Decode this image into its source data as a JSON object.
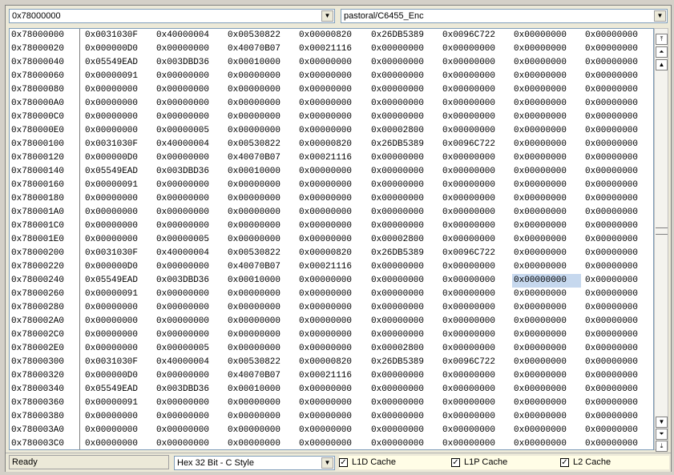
{
  "toolbar": {
    "address_value": "0x78000000",
    "target_value": "pastoral/C6455_Enc"
  },
  "memory": {
    "rows": [
      [
        "0x78000000",
        "0x0031030F",
        "0x40000004",
        "0x00530822",
        "0x00000820",
        "0x26DB5389",
        "0x0096C722",
        "0x00000000",
        "0x00000000"
      ],
      [
        "0x78000020",
        "0x000000D0",
        "0x00000000",
        "0x40070B07",
        "0x00021116",
        "0x00000000",
        "0x00000000",
        "0x00000000",
        "0x00000000"
      ],
      [
        "0x78000040",
        "0x05549EAD",
        "0x003DBD36",
        "0x00010000",
        "0x00000000",
        "0x00000000",
        "0x00000000",
        "0x00000000",
        "0x00000000"
      ],
      [
        "0x78000060",
        "0x00000091",
        "0x00000000",
        "0x00000000",
        "0x00000000",
        "0x00000000",
        "0x00000000",
        "0x00000000",
        "0x00000000"
      ],
      [
        "0x78000080",
        "0x00000000",
        "0x00000000",
        "0x00000000",
        "0x00000000",
        "0x00000000",
        "0x00000000",
        "0x00000000",
        "0x00000000"
      ],
      [
        "0x780000A0",
        "0x00000000",
        "0x00000000",
        "0x00000000",
        "0x00000000",
        "0x00000000",
        "0x00000000",
        "0x00000000",
        "0x00000000"
      ],
      [
        "0x780000C0",
        "0x00000000",
        "0x00000000",
        "0x00000000",
        "0x00000000",
        "0x00000000",
        "0x00000000",
        "0x00000000",
        "0x00000000"
      ],
      [
        "0x780000E0",
        "0x00000000",
        "0x00000005",
        "0x00000000",
        "0x00000000",
        "0x00002800",
        "0x00000000",
        "0x00000000",
        "0x00000000"
      ],
      [
        "0x78000100",
        "0x0031030F",
        "0x40000004",
        "0x00530822",
        "0x00000820",
        "0x26DB5389",
        "0x0096C722",
        "0x00000000",
        "0x00000000"
      ],
      [
        "0x78000120",
        "0x000000D0",
        "0x00000000",
        "0x40070B07",
        "0x00021116",
        "0x00000000",
        "0x00000000",
        "0x00000000",
        "0x00000000"
      ],
      [
        "0x78000140",
        "0x05549EAD",
        "0x003DBD36",
        "0x00010000",
        "0x00000000",
        "0x00000000",
        "0x00000000",
        "0x00000000",
        "0x00000000"
      ],
      [
        "0x78000160",
        "0x00000091",
        "0x00000000",
        "0x00000000",
        "0x00000000",
        "0x00000000",
        "0x00000000",
        "0x00000000",
        "0x00000000"
      ],
      [
        "0x78000180",
        "0x00000000",
        "0x00000000",
        "0x00000000",
        "0x00000000",
        "0x00000000",
        "0x00000000",
        "0x00000000",
        "0x00000000"
      ],
      [
        "0x780001A0",
        "0x00000000",
        "0x00000000",
        "0x00000000",
        "0x00000000",
        "0x00000000",
        "0x00000000",
        "0x00000000",
        "0x00000000"
      ],
      [
        "0x780001C0",
        "0x00000000",
        "0x00000000",
        "0x00000000",
        "0x00000000",
        "0x00000000",
        "0x00000000",
        "0x00000000",
        "0x00000000"
      ],
      [
        "0x780001E0",
        "0x00000000",
        "0x00000005",
        "0x00000000",
        "0x00000000",
        "0x00002800",
        "0x00000000",
        "0x00000000",
        "0x00000000"
      ],
      [
        "0x78000200",
        "0x0031030F",
        "0x40000004",
        "0x00530822",
        "0x00000820",
        "0x26DB5389",
        "0x0096C722",
        "0x00000000",
        "0x00000000"
      ],
      [
        "0x78000220",
        "0x000000D0",
        "0x00000000",
        "0x40070B07",
        "0x00021116",
        "0x00000000",
        "0x00000000",
        "0x00000000",
        "0x00000000"
      ],
      [
        "0x78000240",
        "0x05549EAD",
        "0x003DBD36",
        "0x00010000",
        "0x00000000",
        "0x00000000",
        "0x00000000",
        "0x00000000",
        "0x00000000"
      ],
      [
        "0x78000260",
        "0x00000091",
        "0x00000000",
        "0x00000000",
        "0x00000000",
        "0x00000000",
        "0x00000000",
        "0x00000000",
        "0x00000000"
      ],
      [
        "0x78000280",
        "0x00000000",
        "0x00000000",
        "0x00000000",
        "0x00000000",
        "0x00000000",
        "0x00000000",
        "0x00000000",
        "0x00000000"
      ],
      [
        "0x780002A0",
        "0x00000000",
        "0x00000000",
        "0x00000000",
        "0x00000000",
        "0x00000000",
        "0x00000000",
        "0x00000000",
        "0x00000000"
      ],
      [
        "0x780002C0",
        "0x00000000",
        "0x00000000",
        "0x00000000",
        "0x00000000",
        "0x00000000",
        "0x00000000",
        "0x00000000",
        "0x00000000"
      ],
      [
        "0x780002E0",
        "0x00000000",
        "0x00000005",
        "0x00000000",
        "0x00000000",
        "0x00002800",
        "0x00000000",
        "0x00000000",
        "0x00000000"
      ],
      [
        "0x78000300",
        "0x0031030F",
        "0x40000004",
        "0x00530822",
        "0x00000820",
        "0x26DB5389",
        "0x0096C722",
        "0x00000000",
        "0x00000000"
      ],
      [
        "0x78000320",
        "0x000000D0",
        "0x00000000",
        "0x40070B07",
        "0x00021116",
        "0x00000000",
        "0x00000000",
        "0x00000000",
        "0x00000000"
      ],
      [
        "0x78000340",
        "0x05549EAD",
        "0x003DBD36",
        "0x00010000",
        "0x00000000",
        "0x00000000",
        "0x00000000",
        "0x00000000",
        "0x00000000"
      ],
      [
        "0x78000360",
        "0x00000091",
        "0x00000000",
        "0x00000000",
        "0x00000000",
        "0x00000000",
        "0x00000000",
        "0x00000000",
        "0x00000000"
      ],
      [
        "0x78000380",
        "0x00000000",
        "0x00000000",
        "0x00000000",
        "0x00000000",
        "0x00000000",
        "0x00000000",
        "0x00000000",
        "0x00000000"
      ],
      [
        "0x780003A0",
        "0x00000000",
        "0x00000000",
        "0x00000000",
        "0x00000000",
        "0x00000000",
        "0x00000000",
        "0x00000000",
        "0x00000000"
      ],
      [
        "0x780003C0",
        "0x00000000",
        "0x00000000",
        "0x00000000",
        "0x00000000",
        "0x00000000",
        "0x00000000",
        "0x00000000",
        "0x00000000"
      ]
    ],
    "selected_row": 18,
    "selected_col": 7,
    "selection_color": "#c6d8ee"
  },
  "scrollbar": {
    "icons": [
      "page-up-icon",
      "line-up-icon",
      "arrow-up-icon",
      "arrow-down-icon",
      "line-down-icon",
      "page-down-icon"
    ]
  },
  "status": {
    "text": "Ready",
    "format_value": "Hex 32 Bit - C Style",
    "cache_l1d_label": "L1D Cache",
    "cache_l1p_label": "L1P Cache",
    "cache_l2_label": "L2 Cache",
    "cache_l1d_checked": true,
    "cache_l1p_checked": true,
    "cache_l2_checked": true
  }
}
